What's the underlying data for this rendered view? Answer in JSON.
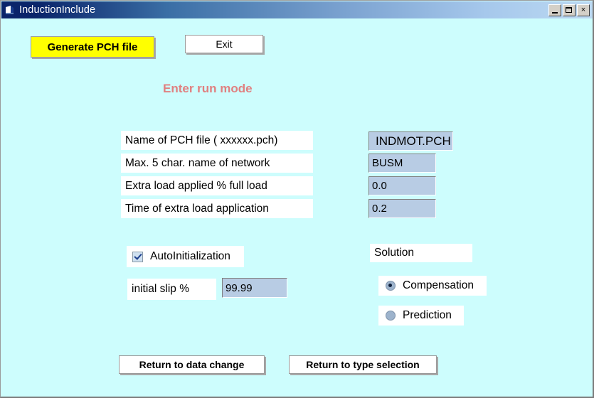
{
  "window": {
    "title": "InductionInclude",
    "icon": "vb-form-icon",
    "controls": {
      "minimize": "minimize-icon",
      "maximize": "maximize-icon",
      "close": "×"
    },
    "background_color": "#CDFDFD"
  },
  "toolbar": {
    "generate_label": "Generate PCH  file",
    "exit_label": "Exit",
    "generate_color": "#FFFF00"
  },
  "heading": {
    "text": "Enter run mode",
    "color": "#E08080"
  },
  "fields": [
    {
      "label": "Name of PCH file ( xxxxxx.pch)",
      "value": "INDMOT.PCH"
    },
    {
      "label": "Max. 5 char. name of  network",
      "value": "BUSM"
    },
    {
      "label": "Extra load applied % full load",
      "value": "0.0"
    },
    {
      "label": "Time of extra load application",
      "value": "0.2"
    }
  ],
  "options": {
    "autoinit_label": "AutoInitialization",
    "autoinit_checked": true,
    "slip_label": "initial slip %",
    "slip_value": "99.99"
  },
  "solution": {
    "title": "Solution",
    "choices": [
      {
        "label": "Compensation",
        "selected": true
      },
      {
        "label": "Prediction",
        "selected": false
      }
    ]
  },
  "footer": {
    "return_data_label": "Return to data change",
    "return_type_label": "Return to type selection"
  }
}
